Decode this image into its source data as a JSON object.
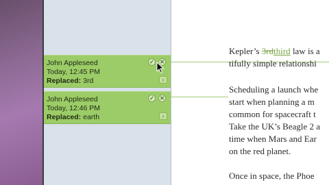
{
  "changes": [
    {
      "author": "John Appleseed",
      "time": "Today, 12:45 PM",
      "action_label": "Replaced:",
      "action_value": "3rd"
    },
    {
      "author": "John Appleseed",
      "time": "Today, 12:46 PM",
      "action_label": "Replaced:",
      "action_value": "earth"
    }
  ],
  "document": {
    "line1_before": "Kepler’s ",
    "line1_deleted": "3rd",
    "line1_inserted": "third",
    "line1_after": " law is a",
    "line2": "tifully simple relationshi",
    "para2": [
      "Scheduling a launch whe",
      "start when planning a m",
      "common for spacecraft t",
      "Take the UK’s Beagle 2 a",
      "time when Mars and Ear",
      "on the red planet."
    ],
    "para3": "Once in space, the Phoe"
  },
  "colors": {
    "card_green": "#9ccc67",
    "sidebar_blue_gray": "#d9e1ea",
    "track_green": "#7aa44a"
  },
  "icons": {
    "accept": "checkmark-icon",
    "reject": "x-icon",
    "expand": "chevron-right-icon"
  }
}
